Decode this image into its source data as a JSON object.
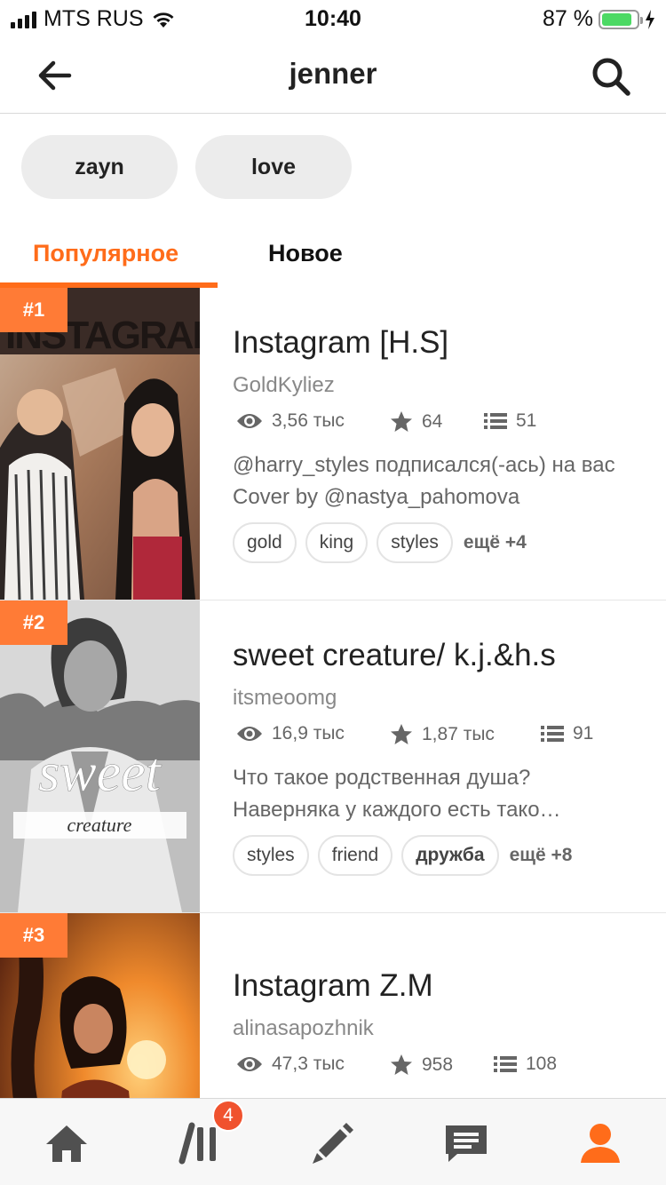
{
  "status_bar": {
    "carrier": "MTS RUS",
    "time": "10:40",
    "battery_percent": "87 %",
    "battery_level": 0.87
  },
  "header": {
    "title": "jenner",
    "back_icon": "arrow-left-icon",
    "search_icon": "search-icon"
  },
  "chips": [
    {
      "label": "zayn"
    },
    {
      "label": "love"
    }
  ],
  "tabs": [
    {
      "label": "Популярное",
      "active": true
    },
    {
      "label": "Новое",
      "active": false
    }
  ],
  "accent_color": "#ff6c1a",
  "stories": [
    {
      "rank": "#1",
      "title": "Instagram [H.S]",
      "author": "GoldKyliez",
      "views": "3,56 тыс",
      "votes": "64",
      "parts": "51",
      "description": "@harry_styles подписался(-ась) на вас Cover by @nastya_pahomova",
      "tags": [
        "gold",
        "king",
        "styles"
      ],
      "more": "ещё +4",
      "cover_text": "INSTAGRAM"
    },
    {
      "rank": "#2",
      "title": "sweet creature/ k.j.&h.s",
      "author": "itsmeoomg",
      "views": "16,9 тыс",
      "votes": "1,87 тыс",
      "parts": "91",
      "description": "Что такое родственная душа? Наверняка у каждого есть тако…",
      "tags": [
        "styles",
        "friend",
        "дружба"
      ],
      "more": "ещё +8",
      "cover_text": "sweet",
      "cover_subtext": "creature"
    },
    {
      "rank": "#3",
      "title": "Instagram Z.M",
      "author": "alinasapozhnik",
      "views": "47,3 тыс",
      "votes": "958",
      "parts": "108"
    }
  ],
  "tab_bar": {
    "items": [
      "home-icon",
      "library-icon",
      "write-icon",
      "messages-icon",
      "profile-icon"
    ],
    "library_badge": "4",
    "active_item": "profile-icon"
  }
}
